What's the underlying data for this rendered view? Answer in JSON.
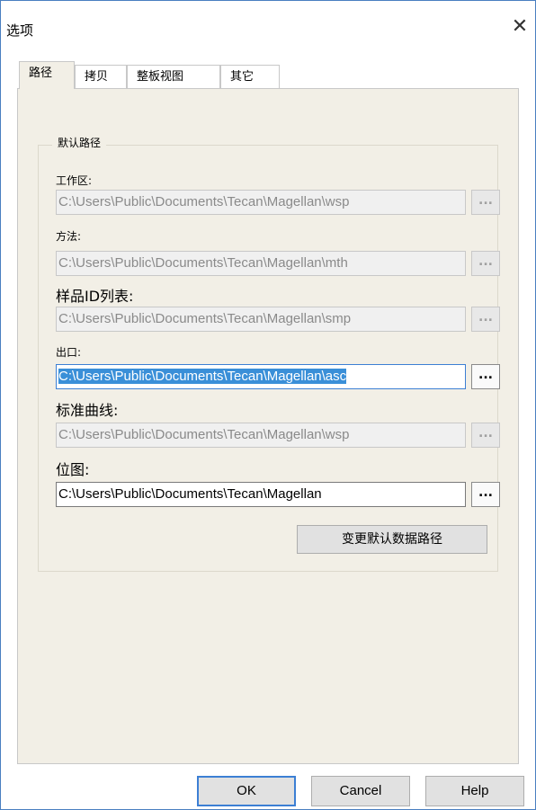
{
  "window": {
    "title": "选项",
    "close_glyph": "✕"
  },
  "tabs": [
    {
      "label": "路径",
      "active": true
    },
    {
      "label": "拷贝",
      "active": false
    },
    {
      "label": "整板视图",
      "active": false
    },
    {
      "label": "其它",
      "active": false
    }
  ],
  "group": {
    "title": "默认路径"
  },
  "fields": [
    {
      "label": "工作区:",
      "value": "C:\\Users\\Public\\Documents\\Tecan\\Magellan\\wsp",
      "enabled": false
    },
    {
      "label": "方法:",
      "value": "C:\\Users\\Public\\Documents\\Tecan\\Magellan\\mth",
      "enabled": false
    },
    {
      "label": "样品ID列表:",
      "value": "C:\\Users\\Public\\Documents\\Tecan\\Magellan\\smp",
      "enabled": false
    },
    {
      "label": "出口:",
      "value": "C:\\Users\\Public\\Documents\\Tecan\\Magellan\\asc",
      "enabled": true,
      "selected": true
    },
    {
      "label": "标准曲线:",
      "value": "C:\\Users\\Public\\Documents\\Tecan\\Magellan\\wsp",
      "enabled": false
    },
    {
      "label": "位图:",
      "value": "C:\\Users\\Public\\Documents\\Tecan\\Magellan",
      "enabled": true
    }
  ],
  "browse_label": "...",
  "change_default_button": "变更默认数据路径",
  "buttons": {
    "ok": "OK",
    "cancel": "Cancel",
    "help": "Help"
  },
  "colors": {
    "accent": "#3c7fd4",
    "panel_bg": "#f2efe6",
    "selection": "#3a8fd8"
  }
}
